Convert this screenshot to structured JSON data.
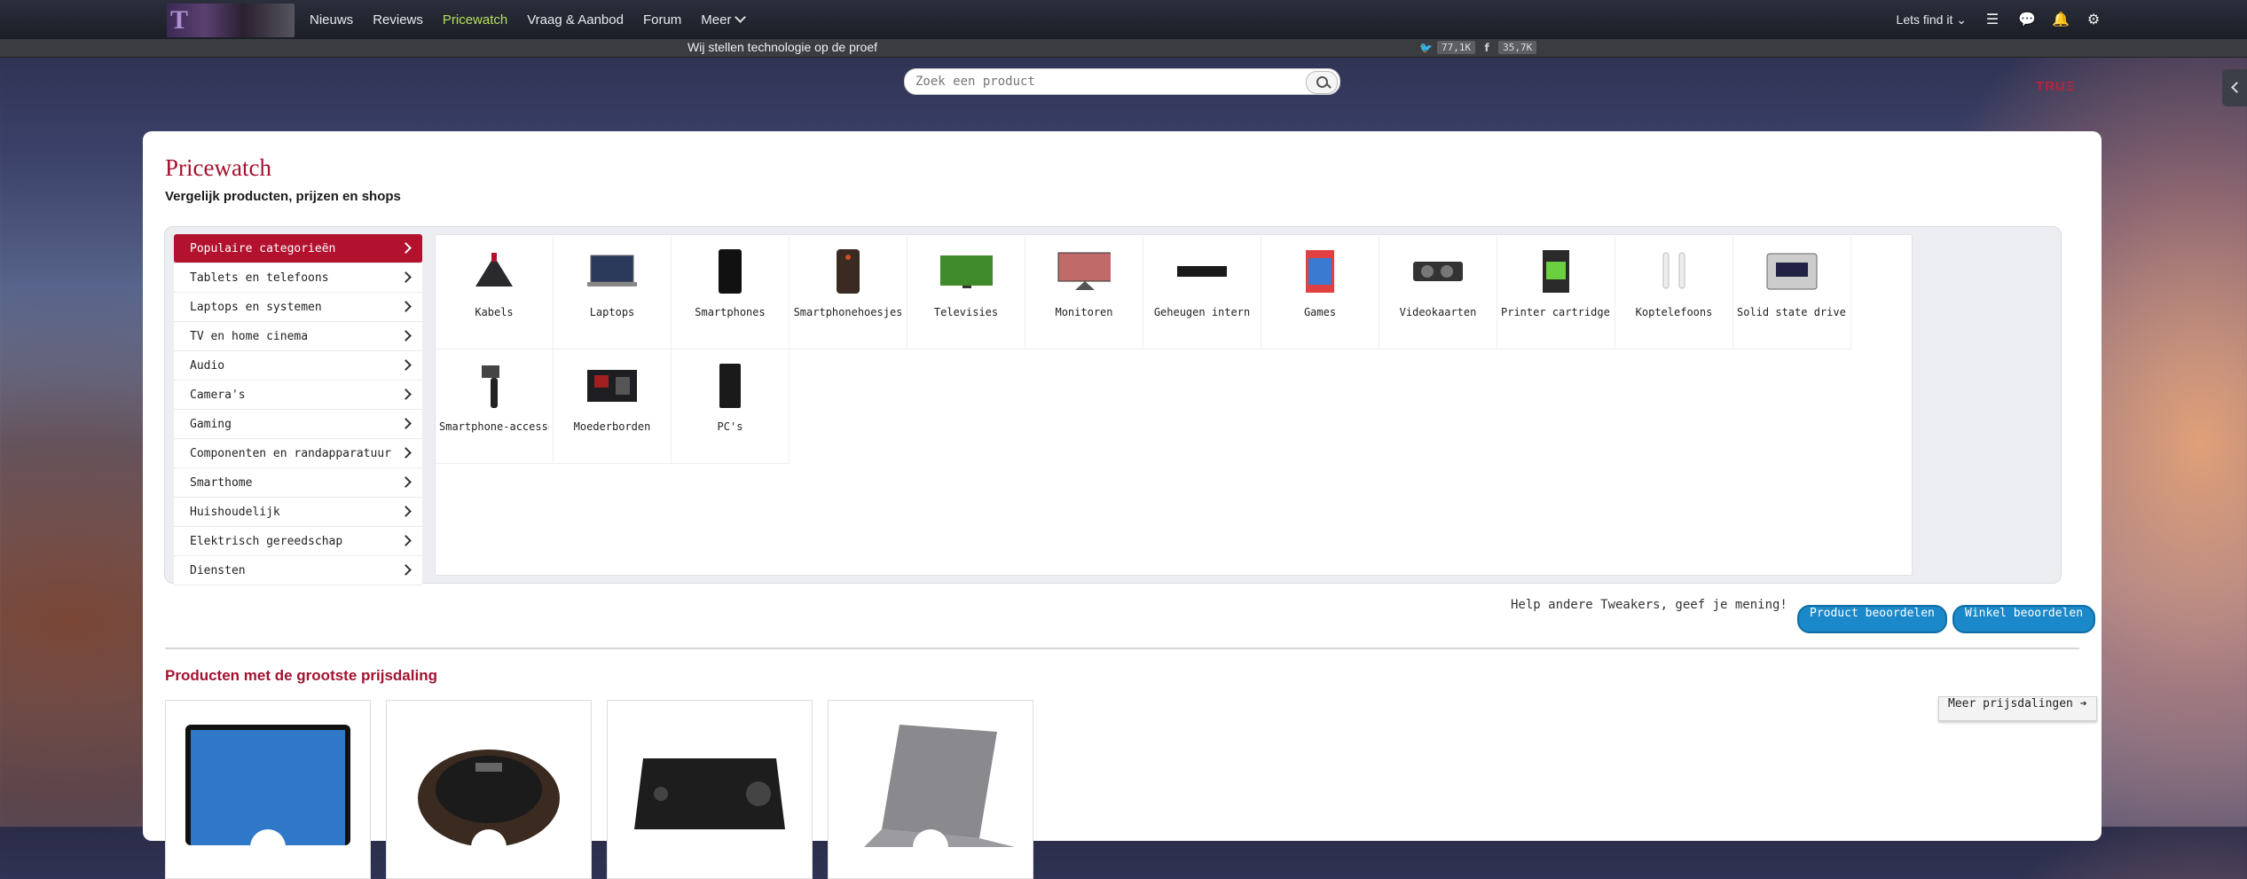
{
  "nav": {
    "items": [
      "Nieuws",
      "Reviews",
      "Pricewatch",
      "Vraag & Aanbod",
      "Forum",
      "Meer"
    ],
    "active": "Pricewatch",
    "lets_find_it": "Lets find it"
  },
  "subbar": {
    "tagline": "Wij stellen technologie op de proef",
    "twitter_count": "77,1K",
    "facebook_count": "35,7K"
  },
  "search": {
    "placeholder": "Zoek een product"
  },
  "sponsor": {
    "logo_text": "TRU",
    "logo_accent": "Ξ"
  },
  "page": {
    "title": "Pricewatch",
    "subtitle": "Vergelijk producten, prijzen en shops"
  },
  "categories": [
    "Populaire categorieën",
    "Tablets en telefoons",
    "Laptops en systemen",
    "TV en home cinema",
    "Audio",
    "Camera's",
    "Gaming",
    "Componenten en randapparatuur",
    "Smarthome",
    "Huishoudelijk",
    "Elektrisch gereedschap",
    "Diensten"
  ],
  "tiles": [
    "Kabels",
    "Laptops",
    "Smartphones",
    "Smartphonehoesjes",
    "Televisies",
    "Monitoren",
    "Geheugen intern",
    "Games",
    "Videokaarten",
    "Printer cartridges",
    "Koptelefoons",
    "Solid state drives",
    "Smartphone-accessoires",
    "Moederborden",
    "PC's"
  ],
  "feedback": {
    "text": "Help andere Tweakers, geef je mening!",
    "product_button": "Product beoordelen",
    "shop_button": "Winkel beoordelen"
  },
  "price_drop": {
    "title": "Producten met de grootste prijsdaling",
    "more_button": "Meer prijsdalingen ➔"
  },
  "colors": {
    "accent": "#a3122f",
    "nav_active": "#b6e05c",
    "button_blue": "#1a88c9"
  }
}
